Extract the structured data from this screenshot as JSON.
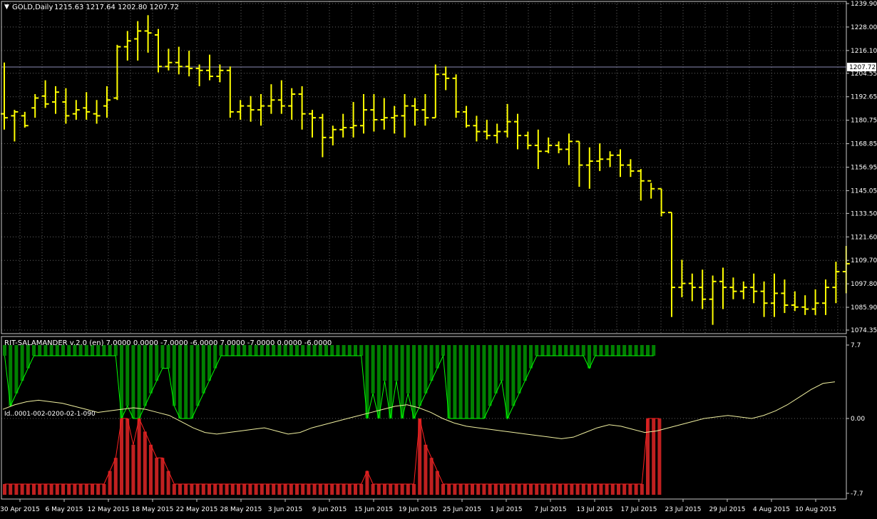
{
  "header": {
    "symbol": "GOLD,Daily",
    "ohlc": "1215.63 1217.64 1202.80 1207.72"
  },
  "indicator": {
    "label": "RIT-SALAMANDER v.2.0 (en) 7.0000 0.0000 -7.0000 -6.0000 7.0000 -7.0000 0.0000 -6.0000",
    "id_label": "Id..0001-002-0200-02-1-090"
  },
  "colors": {
    "background": "#000000",
    "grid": "#646464",
    "frame": "#c8c8c8",
    "candles": "#ffff00",
    "green_hist": "#008000",
    "green_line": "#00ff00",
    "red_hist": "#c02020",
    "red_line": "#ff2020",
    "osc_line": "#f0f0a0",
    "text": "#ffffff",
    "price_line": "#8c8cb4"
  },
  "chart_data": [
    {
      "type": "candlestick",
      "title": "GOLD,Daily",
      "ylim": [
        1074.35,
        1239.9
      ],
      "price_ticks": [
        "1239.90",
        "1228.00",
        "1216.10",
        "1204.55",
        "1192.65",
        "1180.75",
        "1168.85",
        "1156.95",
        "1145.05",
        "1133.50",
        "1121.60",
        "1109.70",
        "1097.80",
        "1085.90",
        "1074.35"
      ],
      "current_price": "1207.72",
      "x_tick_labels": [
        "30 Apr 2015",
        "6 May 2015",
        "12 May 2015",
        "18 May 2015",
        "22 May 2015",
        "28 May 2015",
        "3 Jun 2015",
        "9 Jun 2015",
        "15 Jun 2015",
        "19 Jun 2015",
        "25 Jun 2015",
        "1 Jul 2015",
        "7 Jul 2015",
        "13 Jul 2015",
        "17 Jul 2015",
        "23 Jul 2015",
        "29 Jul 2015",
        "4 Aug 2015",
        "10 Aug 2015"
      ],
      "bars": [
        [
          1184,
          1210,
          1176,
          1182
        ],
        [
          1183,
          1186,
          1170,
          1185
        ],
        [
          1183,
          1185,
          1177,
          1178
        ],
        [
          1187,
          1194,
          1182,
          1192
        ],
        [
          1193,
          1201,
          1187,
          1189
        ],
        [
          1190,
          1198,
          1184,
          1195
        ],
        [
          1190,
          1197,
          1179,
          1183
        ],
        [
          1184,
          1191,
          1181,
          1186
        ],
        [
          1187,
          1195,
          1181,
          1185
        ],
        [
          1184,
          1191,
          1179,
          1183
        ],
        [
          1188,
          1198,
          1182,
          1191
        ],
        [
          1192,
          1219,
          1191,
          1218
        ],
        [
          1218,
          1226,
          1211,
          1221
        ],
        [
          1222,
          1231,
          1211,
          1226
        ],
        [
          1226,
          1234,
          1215,
          1225
        ],
        [
          1224,
          1227,
          1205,
          1208
        ],
        [
          1208,
          1217,
          1206,
          1210
        ],
        [
          1210,
          1218,
          1204,
          1208
        ],
        [
          1208,
          1216,
          1203,
          1207
        ],
        [
          1207,
          1209,
          1198,
          1206
        ],
        [
          1206,
          1214,
          1201,
          1203
        ],
        [
          1203,
          1209,
          1200,
          1206
        ],
        [
          1206,
          1208,
          1182,
          1185
        ],
        [
          1185,
          1191,
          1181,
          1188
        ],
        [
          1188,
          1193,
          1180,
          1186
        ],
        [
          1186,
          1194,
          1178,
          1188
        ],
        [
          1188,
          1199,
          1184,
          1191
        ],
        [
          1191,
          1201,
          1184,
          1188
        ],
        [
          1188,
          1197,
          1181,
          1194
        ],
        [
          1194,
          1198,
          1176,
          1184
        ],
        [
          1184,
          1186,
          1172,
          1182
        ],
        [
          1182,
          1184,
          1162,
          1172
        ],
        [
          1172,
          1178,
          1168,
          1176
        ],
        [
          1176,
          1184,
          1172,
          1177
        ],
        [
          1177,
          1190,
          1172,
          1178
        ],
        [
          1178,
          1194,
          1174,
          1186
        ],
        [
          1186,
          1194,
          1175,
          1181
        ],
        [
          1181,
          1192,
          1176,
          1182
        ],
        [
          1182,
          1188,
          1174,
          1183
        ],
        [
          1183,
          1194,
          1172,
          1188
        ],
        [
          1188,
          1192,
          1178,
          1186
        ],
        [
          1186,
          1194,
          1178,
          1182
        ],
        [
          1182,
          1209,
          1182,
          1204
        ],
        [
          1204,
          1208,
          1196,
          1202
        ],
        [
          1202,
          1204,
          1182,
          1185
        ],
        [
          1185,
          1188,
          1177,
          1178
        ],
        [
          1178,
          1183,
          1170,
          1175
        ],
        [
          1175,
          1181,
          1171,
          1173
        ],
        [
          1173,
          1179,
          1169,
          1175
        ],
        [
          1175,
          1189,
          1172,
          1180
        ],
        [
          1180,
          1184,
          1166,
          1173
        ],
        [
          1173,
          1175,
          1166,
          1168
        ],
        [
          1168,
          1176,
          1156,
          1165
        ],
        [
          1165,
          1172,
          1164,
          1168
        ],
        [
          1168,
          1170,
          1164,
          1166
        ],
        [
          1166,
          1174,
          1158,
          1170
        ],
        [
          1170,
          1170,
          1147,
          1158
        ],
        [
          1158,
          1167,
          1146,
          1160
        ],
        [
          1160,
          1169,
          1155,
          1161
        ],
        [
          1161,
          1165,
          1157,
          1163
        ],
        [
          1163,
          1166,
          1152,
          1158
        ],
        [
          1158,
          1161,
          1152,
          1155
        ],
        [
          1155,
          1156,
          1140,
          1150
        ],
        [
          1150,
          1149,
          1141,
          1146
        ],
        [
          1146,
          1146,
          1132,
          1134
        ],
        [
          1134,
          1134,
          1081,
          1096
        ],
        [
          1096,
          1110,
          1091,
          1098
        ],
        [
          1098,
          1103,
          1089,
          1096
        ],
        [
          1096,
          1105,
          1085,
          1090
        ],
        [
          1090,
          1102,
          1077,
          1099
        ],
        [
          1099,
          1106,
          1085,
          1096
        ],
        [
          1096,
          1101,
          1090,
          1094
        ],
        [
          1094,
          1099,
          1090,
          1096
        ],
        [
          1096,
          1103,
          1088,
          1094
        ],
        [
          1094,
          1099,
          1081,
          1088
        ],
        [
          1088,
          1103,
          1081,
          1093
        ],
        [
          1093,
          1100,
          1083,
          1087
        ],
        [
          1087,
          1094,
          1084,
          1086
        ],
        [
          1086,
          1092,
          1082,
          1085
        ],
        [
          1085,
          1095,
          1082,
          1088
        ],
        [
          1088,
          1100,
          1082,
          1096
        ],
        [
          1096,
          1109,
          1088,
          1104
        ],
        [
          1104,
          1117,
          1093,
          1108
        ]
      ]
    },
    {
      "type": "bar",
      "series_name": "RIT-SALAMANDER v.2.0 (en)",
      "ylim": [
        -7.7,
        7.7
      ],
      "y_ticks": [
        "7.7",
        "0.00",
        "-7.7"
      ],
      "green": [
        6,
        0,
        6,
        6,
        6,
        6,
        6,
        6,
        6,
        6,
        6,
        6,
        6,
        6,
        6,
        6,
        6,
        6,
        6,
        6,
        0,
        6,
        0,
        0,
        6,
        6,
        6,
        6,
        6,
        6,
        6,
        6,
        0,
        6,
        6,
        6,
        6,
        6,
        6,
        6,
        6,
        6,
        6,
        6,
        6,
        6,
        6,
        6,
        6,
        6,
        6,
        0,
        6,
        0,
        6,
        6,
        6,
        6,
        6,
        0,
        6,
        6,
        6,
        0,
        6,
        6,
        6,
        6,
        6,
        6,
        6,
        6,
        6,
        6,
        6,
        6,
        6,
        6,
        6,
        6,
        6,
        6,
        6,
        6,
        6,
        6,
        6,
        6,
        6,
        6,
        6,
        6,
        6,
        6,
        6,
        6,
        6
      ],
      "green_depth": [
        1,
        5,
        4,
        3,
        2,
        1,
        1,
        1,
        1,
        1,
        1,
        1,
        1,
        1,
        1,
        1,
        1,
        1,
        1,
        1,
        6,
        5,
        6,
        6,
        5,
        4,
        3,
        2,
        2,
        5,
        6,
        6,
        6,
        5,
        4,
        3,
        2,
        1,
        1,
        1,
        1,
        1,
        1,
        1,
        1,
        1,
        1,
        1,
        1,
        1,
        1,
        1,
        1,
        1,
        1,
        1,
        1,
        1,
        1,
        1,
        1,
        1,
        6,
        4,
        6,
        3,
        6,
        3,
        6,
        4,
        6,
        5,
        4,
        3,
        2,
        1,
        6,
        6,
        6,
        6,
        6,
        6,
        6,
        5,
        4,
        3,
        6,
        5,
        4,
        3,
        2,
        1,
        1,
        1,
        1,
        1,
        1,
        1,
        1,
        1,
        2,
        1,
        1,
        1,
        1,
        1,
        1,
        1,
        1,
        1,
        1,
        1
      ],
      "red_depth": [
        1,
        1,
        1,
        1,
        1,
        1,
        1,
        1,
        1,
        1,
        1,
        1,
        1,
        1,
        1,
        1,
        1,
        1,
        2,
        3,
        6,
        6,
        4,
        6,
        5,
        4,
        3,
        3,
        2,
        1,
        1,
        1,
        1,
        1,
        1,
        1,
        1,
        1,
        1,
        1,
        1,
        1,
        1,
        1,
        1,
        1,
        1,
        1,
        1,
        1,
        1,
        1,
        1,
        1,
        1,
        1,
        1,
        1,
        1,
        1,
        1,
        1,
        2,
        1,
        1,
        1,
        1,
        1,
        1,
        1,
        1,
        6,
        4,
        3,
        2,
        1,
        1,
        1,
        1,
        1,
        1,
        1,
        1,
        1,
        1,
        1,
        1,
        1,
        1,
        1,
        1,
        1,
        1,
        1,
        1,
        1,
        1,
        1,
        1,
        1,
        1,
        1,
        1,
        1,
        1,
        1,
        1,
        1,
        1,
        1,
        6,
        6,
        6
      ],
      "osc_line": [
        0.3,
        0.45,
        0.55,
        0.6,
        0.55,
        0.5,
        0.4,
        0.3,
        0.2,
        0.25,
        0.3,
        0.35,
        0.3,
        0.2,
        0.1,
        -0.1,
        -0.3,
        -0.45,
        -0.5,
        -0.45,
        -0.4,
        -0.35,
        -0.3,
        -0.4,
        -0.5,
        -0.45,
        -0.3,
        -0.2,
        -0.1,
        0,
        0.1,
        0.2,
        0.3,
        0.4,
        0.45,
        0.35,
        0.2,
        0.0,
        -0.15,
        -0.25,
        -0.3,
        -0.35,
        -0.4,
        -0.45,
        -0.5,
        -0.55,
        -0.6,
        -0.65,
        -0.6,
        -0.45,
        -0.3,
        -0.2,
        -0.25,
        -0.35,
        -0.45,
        -0.4,
        -0.3,
        -0.2,
        -0.1,
        0.0,
        0.05,
        0.1,
        0.05,
        0.0,
        0.1,
        0.25,
        0.45,
        0.7,
        0.95,
        1.15,
        1.2
      ]
    }
  ]
}
